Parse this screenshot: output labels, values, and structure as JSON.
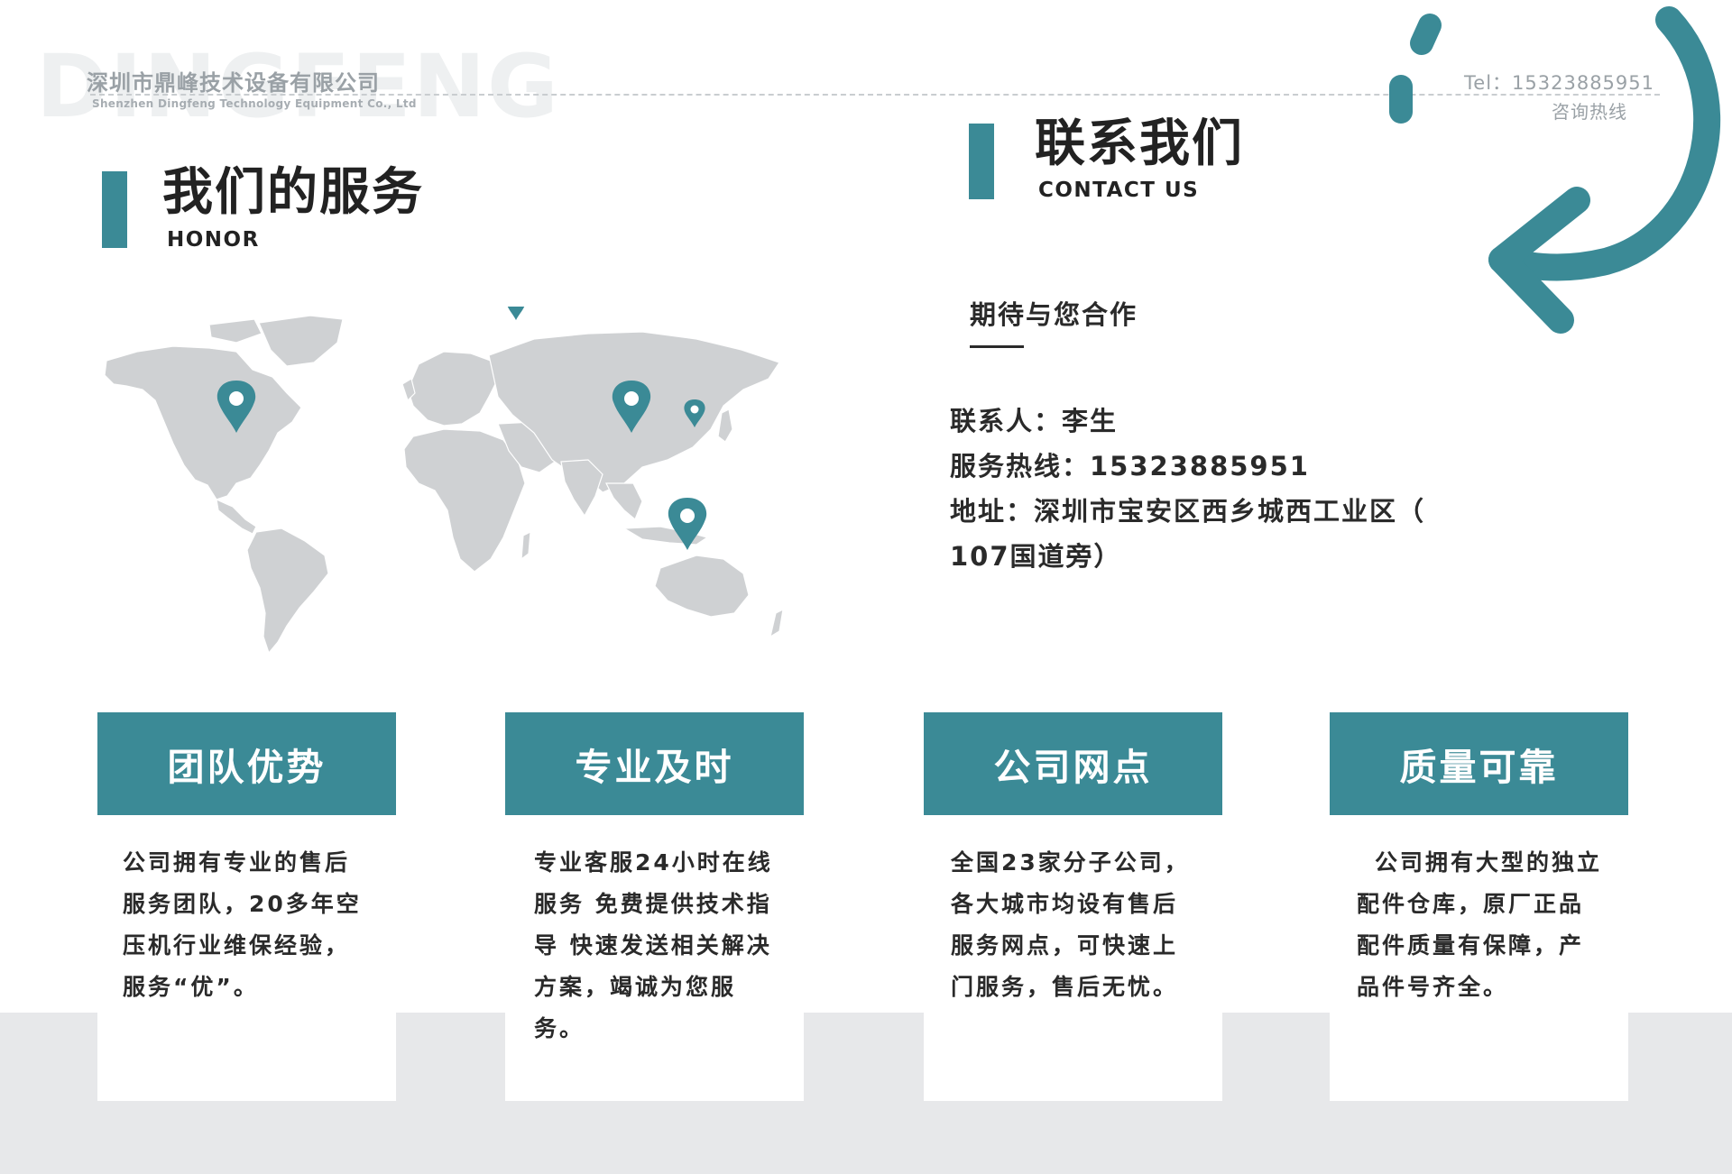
{
  "header": {
    "watermark": "DINGFENG",
    "company_cn": "深圳市鼎峰技术设备有限公司",
    "company_en": "Shenzhen Dingfeng Technology Equipment Co., Ltd",
    "tel": "Tel：15323885951",
    "hotline_label": "咨询热线"
  },
  "services_section": {
    "title": "我们的服务",
    "subtitle": "HONOR"
  },
  "contact_section": {
    "title": "联系我们",
    "subtitle": "CONTACT US",
    "intro": "期待与您合作",
    "lines": [
      "联系人：李生",
      "服务热线：15323885951",
      "地址：深圳市宝安区西乡城西工业区（",
      "107国道旁）"
    ]
  },
  "cards": [
    {
      "title": "团队优势",
      "body": "公司拥有专业的售后服务团队，20多年空压机行业维保经验，服务“优”。"
    },
    {
      "title": "专业及时",
      "body": "专业客服24小时在线服务 免费提供技术指导 快速发送相关解决方案，竭诚为您服务。"
    },
    {
      "title": "公司网点",
      "body": "全国23家分子公司，各大城市均设有售后服务网点，可快速上门服务，售后无忧。"
    },
    {
      "title": "质量可靠",
      "body": "公司拥有大型的独立配件仓库，原厂正品配件质量有保障，产品件号齐全。"
    }
  ],
  "colors": {
    "accent": "#3b8a96",
    "map_land": "#cfd1d3",
    "band": "#e7e8ea"
  },
  "icons": [
    "location-pin-icon",
    "curved-arrow-icon",
    "world-map"
  ]
}
